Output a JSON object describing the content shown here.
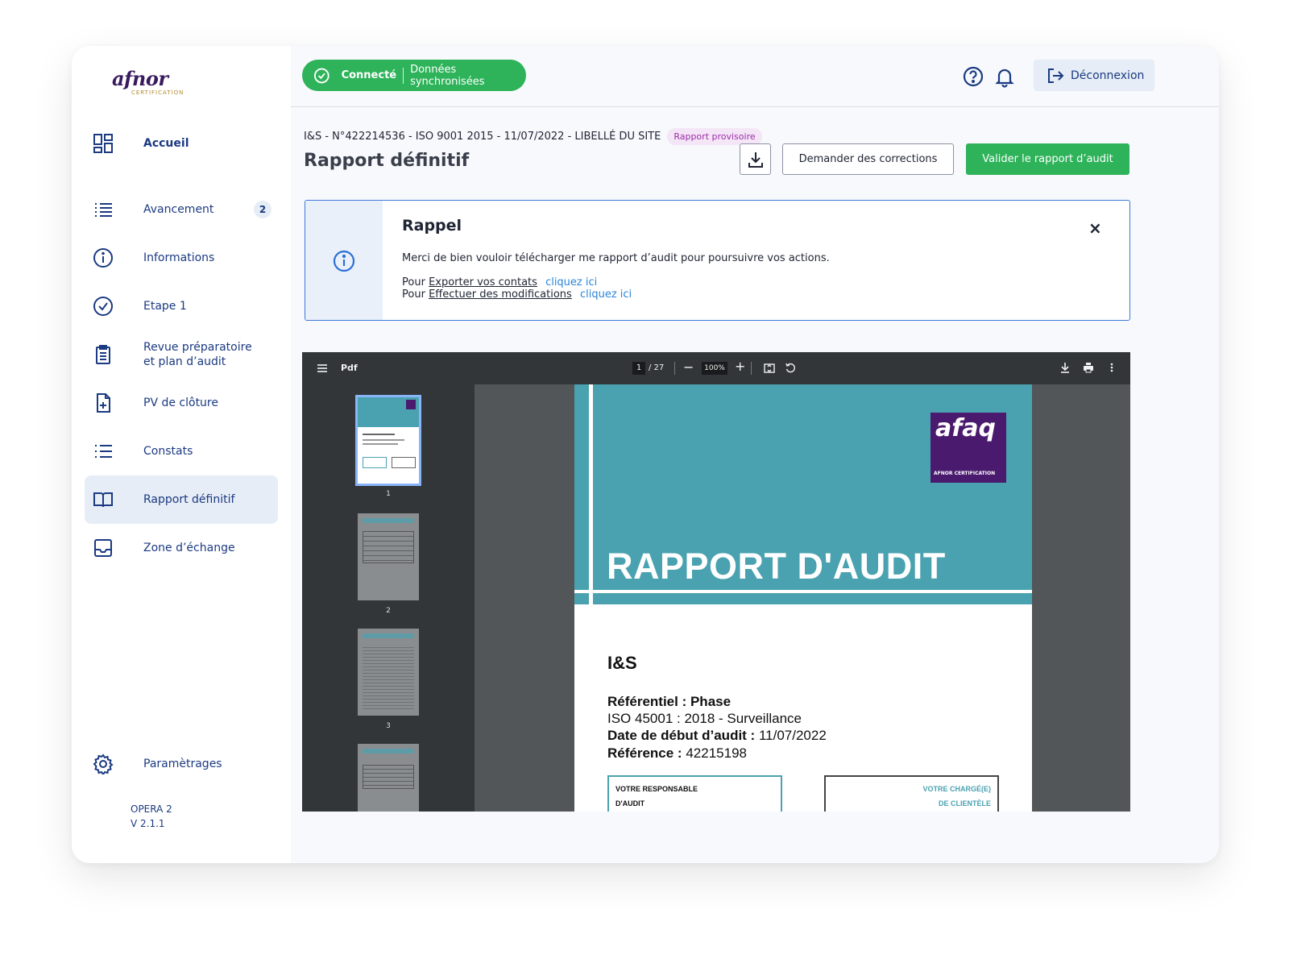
{
  "brand": {
    "logo": "afnor",
    "logo_sub": "CERTIFICATION"
  },
  "sidebar": {
    "items": [
      {
        "label": "Accueil",
        "icon": "dashboard-icon",
        "active": false
      },
      {
        "label": "Avancement",
        "icon": "list-icon",
        "badge": "2"
      },
      {
        "label": "Informations",
        "icon": "info-icon"
      },
      {
        "label": "Etape 1",
        "icon": "check-circle-icon"
      },
      {
        "label": "Revue préparatoire",
        "label2": "et plan d’audit",
        "icon": "clipboard-icon"
      },
      {
        "label": "PV de clôture",
        "icon": "file-plus-icon"
      },
      {
        "label": "Constats",
        "icon": "bullet-list-icon"
      },
      {
        "label": "Rapport définitif",
        "icon": "book-icon",
        "active": true
      },
      {
        "label": "Zone d’échange",
        "icon": "inbox-icon"
      }
    ],
    "settings": {
      "label": "Paramètrages",
      "icon": "gear-icon"
    },
    "version": {
      "line1": "OPERA 2",
      "line2": "V 2.1.1"
    }
  },
  "header": {
    "status_connected": "Connecté",
    "status_sync": "Données synchronisées",
    "logout": "Déconnexion"
  },
  "main": {
    "breadcrumb": "I&S -  N°422214536 - ISO 9001 2015 - 11/07/2022 - LIBELLÉ DU SITE",
    "tag": "Rapport provisoire",
    "title": "Rapport définitif",
    "btn_corrections": "Demander des corrections",
    "btn_validate": "Valider le rapport d’audit"
  },
  "alert": {
    "title": "Rappel",
    "close": "×",
    "message": "Merci de bien vouloir télécharger me rapport d’audit pour poursuivre vos actions.",
    "line1_prefix": "Pour",
    "line1_link_text": "Exporter vos contats",
    "line1_action": "cliquez ici",
    "line2_prefix": "Pour",
    "line2_link_text": "Effectuer des modifications",
    "line2_action": "cliquez ici"
  },
  "pdf": {
    "title": "Pdf",
    "page_current": "1",
    "page_total": "/ 27",
    "zoom": "100%",
    "thumb_numbers": [
      "1",
      "2",
      "3"
    ],
    "doc": {
      "brand": "afaq",
      "brand_sub": "AFNOR CERTIFICATION",
      "heading": "RAPPORT D'AUDIT",
      "company": "I&S",
      "ref_label": "Référentiel : Phase",
      "ref_value": "ISO 45001 : 2018 - Surveillance",
      "date_label": "Date de début d’audit :",
      "date_value": "11/07/2022",
      "reference_label": "Référence :",
      "reference_value": "42215198",
      "box1_l1": "VOTRE RESPONSABLE",
      "box1_l2": "D'AUDIT",
      "box2_l1": "VOTRE CHARGÉ(E)",
      "box2_l2": "DE CLIENTÈLE"
    }
  }
}
